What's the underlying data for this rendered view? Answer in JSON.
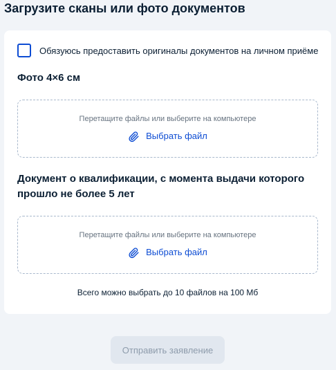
{
  "page": {
    "title": "Загрузите сканы или фото документов"
  },
  "form": {
    "checkbox_label": "Обязуюсь предоставить оригиналы документов на личном приёме",
    "checkbox_checked": false,
    "sections": [
      {
        "title": "Фото 4×6 см",
        "dropzone_hint": "Перетащите файлы или выберите на компьютере",
        "choose_file_label": "Выбрать файл",
        "icon": "paperclip-icon"
      },
      {
        "title": "Документ о квалификации, с момента выдачи которого прошло не более 5 лет",
        "dropzone_hint": "Перетащите файлы или выберите на компьютере",
        "choose_file_label": "Выбрать файл",
        "icon": "paperclip-icon"
      }
    ],
    "limit_note": "Всего можно выбрать до 10 файлов на 100 Мб"
  },
  "actions": {
    "submit_label": "Отправить заявление",
    "submit_disabled": true
  },
  "colors": {
    "accent": "#0d4cd3",
    "background": "#f1f4f8",
    "text": "#0b1f33",
    "muted_text": "#66727f",
    "dashed_border": "#a8b8cc",
    "button_disabled_bg": "#e1e7ef",
    "button_disabled_text": "#8d9bab"
  }
}
